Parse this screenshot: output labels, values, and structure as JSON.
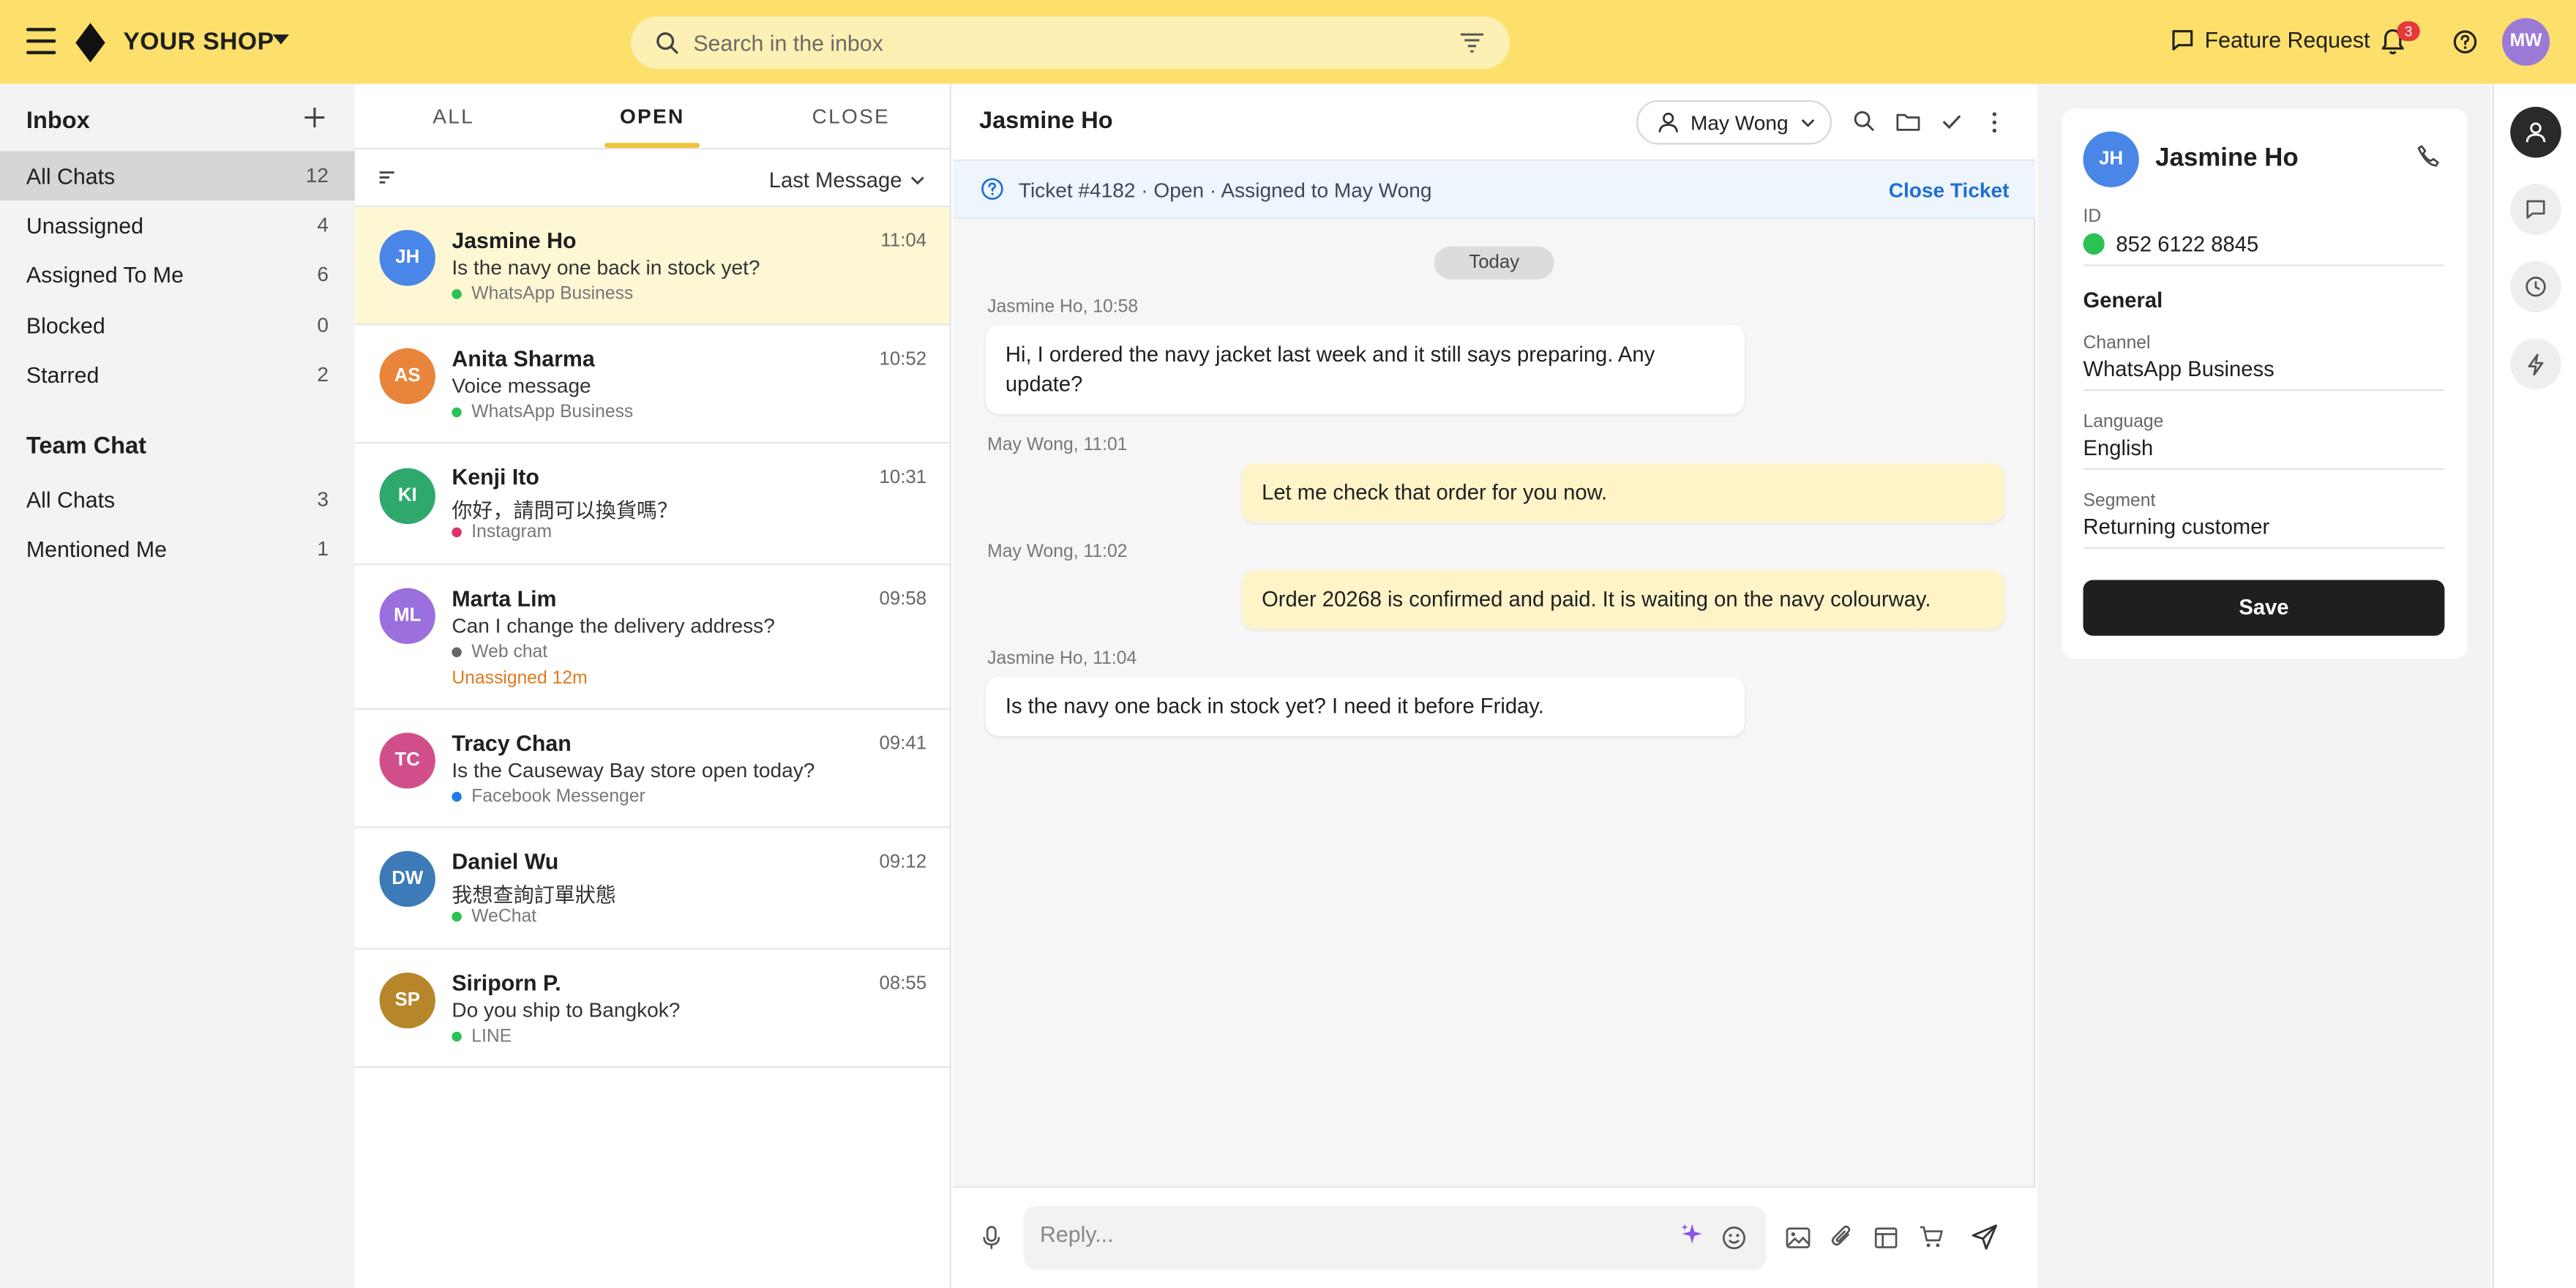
{
  "topbar": {
    "shop_name": "YOUR SHOP",
    "search_placeholder": "Search in the inbox",
    "feature_request": "Feature Request",
    "notifications_count": "3",
    "user_initials": "MW"
  },
  "sidebar": {
    "inbox_title": "Inbox",
    "inbox_items": [
      {
        "label": "All Chats",
        "count": "12"
      },
      {
        "label": "Unassigned",
        "count": "4"
      },
      {
        "label": "Assigned To Me",
        "count": "6"
      },
      {
        "label": "Blocked",
        "count": "0"
      },
      {
        "label": "Starred",
        "count": "2"
      }
    ],
    "team_title": "Team Chat",
    "team_items": [
      {
        "label": "All Chats",
        "count": "3"
      },
      {
        "label": "Mentioned Me",
        "count": "1"
      }
    ]
  },
  "chatlist": {
    "tabs": [
      "ALL",
      "OPEN",
      "CLOSE"
    ],
    "sort_label": "Last Message",
    "conversations": [
      {
        "initials": "JH",
        "name": "Jasmine Ho",
        "time": "11:04",
        "message": "Is the navy one back in stock yet?",
        "channel": "WhatsApp Business",
        "avatar_color": "#4a86e8",
        "dot_color": "#2bc153"
      },
      {
        "initials": "AS",
        "name": "Anita Sharma",
        "time": "10:52",
        "message": "Voice message",
        "channel": "WhatsApp Business",
        "avatar_color": "#e8853a",
        "dot_color": "#2bc153"
      },
      {
        "initials": "KI",
        "name": "Kenji Ito",
        "time": "10:31",
        "message": "你好，請問可以換貨嗎？",
        "channel": "Instagram",
        "avatar_color": "#2fa86e",
        "dot_color": "#e0306b"
      },
      {
        "initials": "ML",
        "name": "Marta Lim",
        "time": "09:58",
        "message": "Can I change the delivery address?",
        "channel": "Web chat",
        "avatar_color": "#9b6fde",
        "dot_color": "#666666",
        "warning": "Unassigned 12m"
      },
      {
        "initials": "TC",
        "name": "Tracy Chan",
        "time": "09:41",
        "message": "Is the Causeway Bay store open today?",
        "channel": "Facebook Messenger",
        "avatar_color": "#d04f8a",
        "dot_color": "#1f7bea"
      },
      {
        "initials": "DW",
        "name": "Daniel Wu",
        "time": "09:12",
        "message": "我想查詢訂單狀態",
        "channel": "WeChat",
        "avatar_color": "#3d7ab8",
        "dot_color": "#2bc153"
      },
      {
        "initials": "SP",
        "name": "Siriporn P.",
        "time": "08:55",
        "message": "Do you ship to Bangkok?",
        "channel": "LINE",
        "avatar_color": "#b8862a",
        "dot_color": "#2bc153"
      }
    ]
  },
  "chat": {
    "title": "Jasmine Ho",
    "assignee": "May Wong",
    "ticket_text": "Ticket #4182 · Open · Assigned to May Wong",
    "close_ticket": "Close Ticket",
    "today_label": "Today",
    "messages": [
      {
        "meta": "Jasmine Ho, 10:58",
        "text": "Hi, I ordered the navy jacket last week and it still says preparing. Any update?",
        "dir": "in"
      },
      {
        "meta": "May Wong, 11:01",
        "text": "Let me check that order for you now.",
        "dir": "out"
      },
      {
        "meta": "May Wong, 11:02",
        "text": "Order 20268 is confirmed and paid. It is waiting on the navy colourway.",
        "dir": "out"
      },
      {
        "meta": "Jasmine Ho, 11:04",
        "text": "Is the navy one back in stock yet? I need it before Friday.",
        "dir": "in"
      }
    ],
    "reply_placeholder": "Reply..."
  },
  "details": {
    "initials": "JH",
    "name": "Jasmine Ho",
    "id_label": "ID",
    "id_value": "852 6122 8845",
    "section_title": "General",
    "channel_label": "Channel",
    "channel_value": "WhatsApp Business",
    "language_label": "Language",
    "language_value": "English",
    "segment_label": "Segment",
    "segment_value": "Returning customer",
    "save_label": "Save"
  },
  "colors": {
    "accent_yellow": "#fddf6b",
    "tab_underline": "#f0c23a",
    "link_blue": "#1f6ed4",
    "warning_orange": "#e07a1f"
  }
}
